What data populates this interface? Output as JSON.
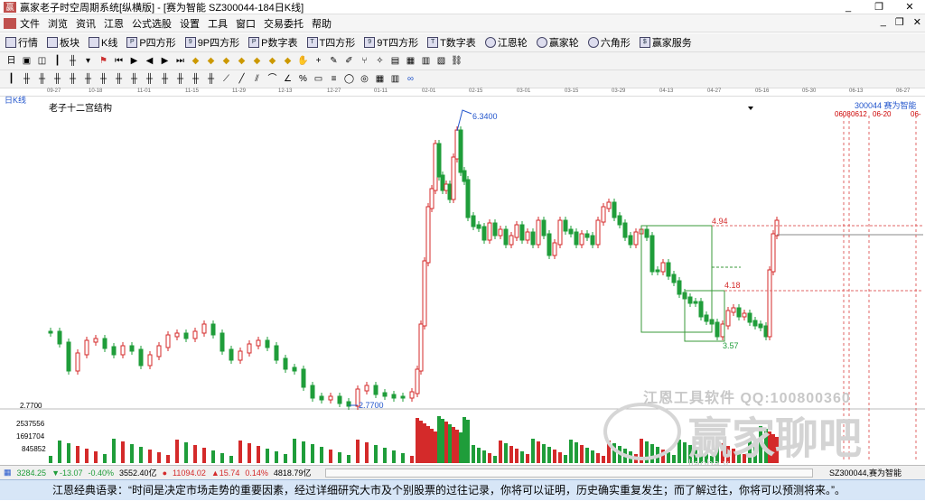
{
  "window": {
    "title": "赢家老子时空周期系统[纵横版] - [赛为智能  SZ300044-184日K线]",
    "min_label": "_",
    "max_label": "❐",
    "close_label": "✕"
  },
  "menu": [
    "文件",
    "浏览",
    "资讯",
    "江恩",
    "公式选股",
    "设置",
    "工具",
    "窗口",
    "交易委托",
    "帮助"
  ],
  "menu_right": [
    "_",
    "❐",
    "✕"
  ],
  "toolbar1": [
    {
      "icon": "grid-icon",
      "label": "行情"
    },
    {
      "icon": "board-icon",
      "label": "板块"
    },
    {
      "icon": "kline-icon",
      "label": "K线"
    },
    {
      "icon": "p-square-icon",
      "label": "P四方形"
    },
    {
      "icon": "9p-square-icon",
      "label": "9P四方形"
    },
    {
      "icon": "p-number-icon",
      "label": "P数字表"
    },
    {
      "icon": "t-square-icon",
      "label": "T四方形"
    },
    {
      "icon": "9t-square-icon",
      "label": "9T四方形"
    },
    {
      "icon": "t-number-icon",
      "label": "T数字表"
    },
    {
      "icon": "gann-wheel-icon",
      "label": "江恩轮"
    },
    {
      "icon": "winner-wheel-icon",
      "label": "赢家轮"
    },
    {
      "icon": "hexagon-icon",
      "label": "六角形"
    },
    {
      "icon": "service-icon",
      "label": "赢家服务"
    }
  ],
  "chart_title": "日K线",
  "indicator": "老子十二宫结构",
  "stock_code": "300044 赛为智能",
  "date_labels": [
    "09-27",
    "10-18",
    "11-01",
    "11-15",
    "11-29",
    "12-13",
    "12-27",
    "01-11",
    "02-01",
    "02-15",
    "03-01",
    "03-15",
    "03-29",
    "04-13",
    "04-27",
    "05-16",
    "05-30",
    "06-13",
    "06-27"
  ],
  "date_markers": [
    "0608",
    "0612",
    "06-20",
    "06-"
  ],
  "annotations": {
    "high": "6.3400",
    "low": "2.7700",
    "box_top": "4.94",
    "box_mid": "4.18",
    "box_low": "3.57"
  },
  "y_labels": {
    "price_low": "2.7700",
    "vol1": "2537556",
    "vol2": "1691704",
    "vol3": "845852"
  },
  "watermark": {
    "line1": "江恩工具软件  QQ:100800360",
    "line2": "赢家聊吧",
    "line3": "liaoba.y..."
  },
  "status": {
    "sh_index": "3284.25",
    "sh_change": "▼-13.07",
    "sh_pct": "-0.40%",
    "sh_amount": "3552.40亿",
    "sz_index": "11094.02",
    "sz_change": "▲15.74",
    "sz_pct": "0.14%",
    "sz_amount": "4818.79亿",
    "current": "SZ300044,赛为智能"
  },
  "quote": "江恩经典语录：“时间是决定市场走势的重要因素，经过详细研究大市及个别股票的过往记录，你将可以证明，历史确实重复发生；而了解过往，你将可以预测将来。”。",
  "colors": {
    "up": "#d42a2a",
    "down": "#1f9d3a",
    "box": "#3a9a3a",
    "grid": "#e06666"
  }
}
